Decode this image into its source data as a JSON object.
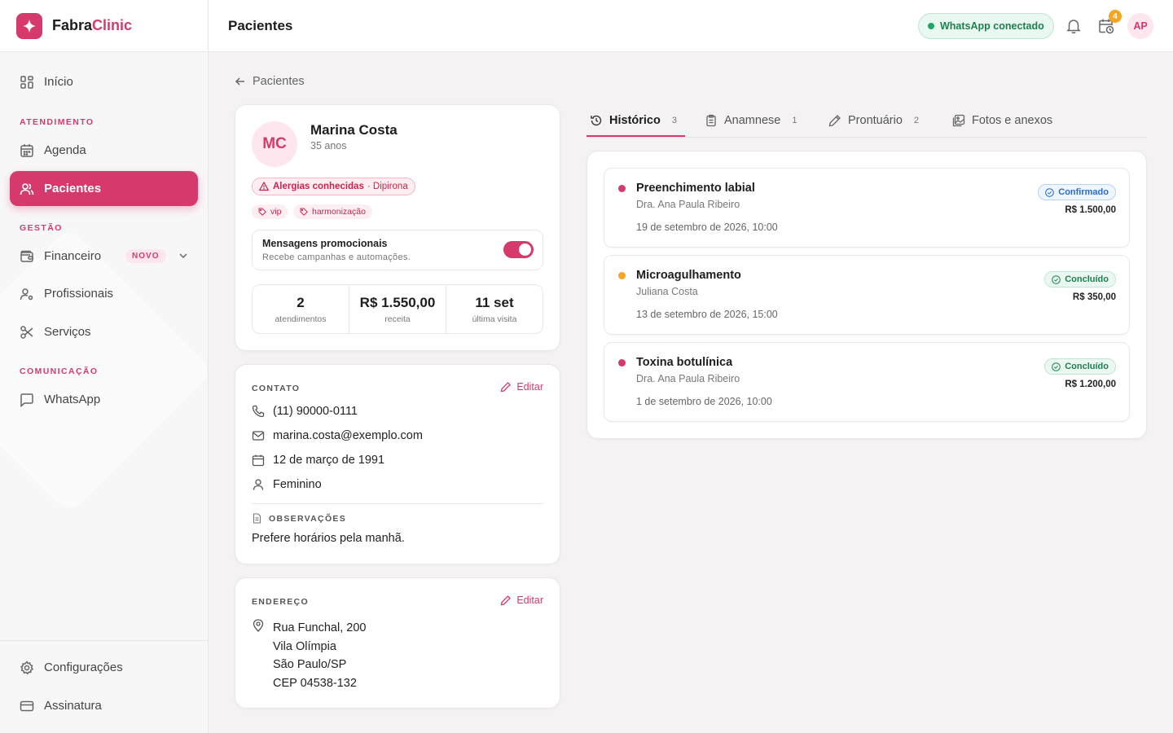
{
  "brand": {
    "name_part1": "Fabra",
    "name_part2": "Clinic"
  },
  "sidebar": {
    "items": [
      {
        "label": "Início",
        "icon": "dashboard-icon"
      },
      {
        "label": "Agenda",
        "icon": "calendar-icon"
      },
      {
        "label": "Pacientes",
        "icon": "users-icon",
        "active": true
      },
      {
        "label": "Financeiro",
        "icon": "wallet-icon",
        "badge": "NOVO"
      },
      {
        "label": "Profissionais",
        "icon": "user-gear-icon"
      },
      {
        "label": "Serviços",
        "icon": "scissors-icon"
      },
      {
        "label": "WhatsApp",
        "icon": "chat-icon"
      },
      {
        "label": "Configurações",
        "icon": "gear-icon"
      },
      {
        "label": "Assinatura",
        "icon": "credit-card-icon"
      }
    ],
    "sections": [
      "ATENDIMENTO",
      "GESTÃO",
      "COMUNICAÇÃO"
    ]
  },
  "topbar": {
    "title": "Pacientes",
    "whatsapp_status": "WhatsApp conectado",
    "reminders_count": "4",
    "user_initials": "AP"
  },
  "breadcrumb": {
    "back_label": "Pacientes"
  },
  "patient": {
    "initials": "MC",
    "name": "Marina Costa",
    "age": "35 anos",
    "allergy_label": "Alergias conhecidas",
    "allergy_value": "· Dipirona",
    "tags": [
      "vip",
      "harmonização"
    ],
    "promo_title": "Mensagens promocionais",
    "promo_subtitle": "Recebe campanhas e automações.",
    "promo_enabled": true,
    "stats": [
      {
        "value": "2",
        "label": "atendimentos"
      },
      {
        "value": "R$ 1.550,00",
        "label": "receita"
      },
      {
        "value": "11 set",
        "label": "última visita"
      }
    ]
  },
  "contact": {
    "label": "CONTATO",
    "edit_label": "Editar",
    "phone": "(11) 90000-0111",
    "email": "marina.costa@exemplo.com",
    "birthdate": "12 de março de 1991",
    "gender": "Feminino",
    "notes_label": "OBSERVAÇÕES",
    "notes": "Prefere horários pela manhã."
  },
  "address": {
    "label": "ENDEREÇO",
    "edit_label": "Editar",
    "street": "Rua Funchal, 200",
    "district": "Vila Olímpia",
    "city": "São Paulo/SP",
    "zip": "CEP 04538-132"
  },
  "tabs": [
    {
      "label": "Histórico",
      "count": "3",
      "icon": "history-icon",
      "active": true
    },
    {
      "label": "Anamnese",
      "count": "1",
      "icon": "clipboard-icon"
    },
    {
      "label": "Prontuário",
      "count": "2",
      "icon": "pen-icon"
    },
    {
      "label": "Fotos e anexos",
      "count": "",
      "icon": "images-icon"
    }
  ],
  "history": [
    {
      "title": "Preenchimento labial",
      "professional": "Dra. Ana Paula Ribeiro",
      "date": "19 de setembro de 2026, 10:00",
      "status": "Confirmado",
      "price": "R$ 1.500,00",
      "dot_color": "#d63a6a"
    },
    {
      "title": "Microagulhamento",
      "professional": "Juliana Costa",
      "date": "13 de setembro de 2026, 15:00",
      "status": "Concluído",
      "price": "R$ 350,00",
      "dot_color": "#f5a623"
    },
    {
      "title": "Toxina botulínica",
      "professional": "Dra. Ana Paula Ribeiro",
      "date": "1 de setembro de 2026, 10:00",
      "status": "Concluído",
      "price": "R$ 1.200,00",
      "dot_color": "#d63a6a"
    }
  ],
  "colors": {
    "accent": "#d63a6a",
    "success": "#1e7f51",
    "info": "#2a6cc2",
    "warning": "#f5a623"
  }
}
